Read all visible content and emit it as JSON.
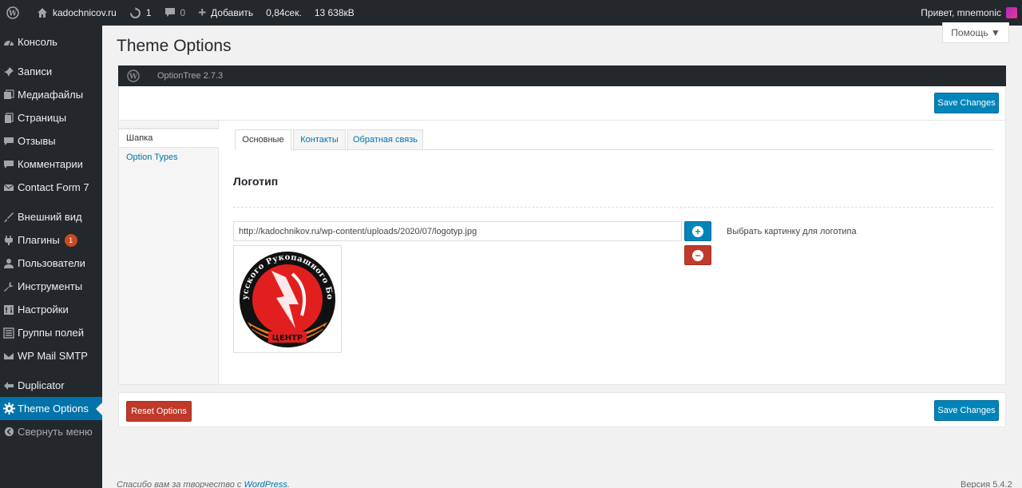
{
  "adminbar": {
    "site_name": "kadochnicov.ru",
    "updates_count": "1",
    "comments_count": "0",
    "add_label": "Добавить",
    "load_time": "0,84сек.",
    "memory": "13 638кВ",
    "greeting": "Привет, mnemonic"
  },
  "sidebar": {
    "items": [
      {
        "label": "Консоль",
        "icon": "dashboard-icon"
      },
      {
        "label": "Записи",
        "icon": "pin-icon"
      },
      {
        "label": "Медиафайлы",
        "icon": "media-icon"
      },
      {
        "label": "Страницы",
        "icon": "pages-icon"
      },
      {
        "label": "Отзывы",
        "icon": "reviews-icon"
      },
      {
        "label": "Комментарии",
        "icon": "comment-icon"
      },
      {
        "label": "Contact Form 7",
        "icon": "mail-icon"
      },
      {
        "label": "Внешний вид",
        "icon": "brush-icon"
      },
      {
        "label": "Плагины",
        "icon": "plugin-icon",
        "badge": "1"
      },
      {
        "label": "Пользователи",
        "icon": "user-icon"
      },
      {
        "label": "Инструменты",
        "icon": "wrench-icon"
      },
      {
        "label": "Настройки",
        "icon": "settings-icon"
      },
      {
        "label": "Группы полей",
        "icon": "fields-icon"
      },
      {
        "label": "WP Mail SMTP",
        "icon": "mail-smtp-icon"
      },
      {
        "label": "Duplicator",
        "icon": "duplicator-icon"
      },
      {
        "label": "Theme Options",
        "icon": "gear-icon"
      },
      {
        "label": "Свернуть меню",
        "icon": "collapse-icon"
      }
    ]
  },
  "help_label": "Помощь ▼",
  "page_title": "Theme Options",
  "optiontree_version": "OptionTree 2.7.3",
  "save_label": "Save Changes",
  "reset_label": "Reset Options",
  "left_nav": [
    "Шапка",
    "Option Types"
  ],
  "tabs": [
    "Основные",
    "Контакты",
    "Обратная связь"
  ],
  "section_title": "Логотип",
  "logo_url": "http://kadochnikov.ru/wp-content/uploads/2020/07/logotyp.jpg",
  "logo_desc": "Выбрать картинку для логотипа",
  "logo_text_top": "Русского Рукопашного Боя",
  "logo_text_bottom": "ЦЕНТР",
  "footer": {
    "text": "Спасибо вам за творчество с ",
    "link": "WordPress",
    "end": ".",
    "version": "Версия 5.4.2"
  },
  "colors": {
    "adminbar": "#23282d",
    "accent": "#0085ba",
    "danger": "#c0392b",
    "current_menu": "#0073aa"
  }
}
